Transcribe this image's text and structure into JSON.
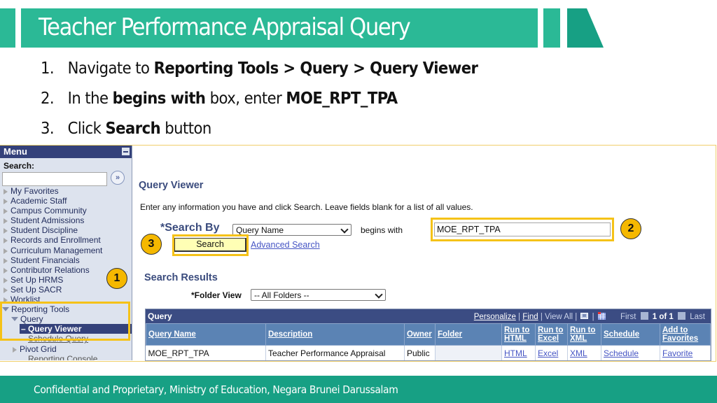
{
  "slide": {
    "title": "Teacher Performance Appraisal Query",
    "steps": [
      {
        "num": "1.",
        "parts": [
          {
            "t": "Navigate to ",
            "b": false
          },
          {
            "t": "Reporting Tools > Query > Query Viewer",
            "b": true
          }
        ]
      },
      {
        "num": "2.",
        "parts": [
          {
            "t": "In the ",
            "b": false
          },
          {
            "t": "begins with",
            "b": true
          },
          {
            "t": " box, enter ",
            "b": false
          },
          {
            "t": "MOE_RPT_TPA",
            "b": true
          }
        ]
      },
      {
        "num": "3.",
        "parts": [
          {
            "t": "Click ",
            "b": false
          },
          {
            "t": "Search",
            "b": true
          },
          {
            "t": " button",
            "b": false
          }
        ]
      }
    ],
    "footer": "Confidential and Proprietary, Ministry of Education, Negara Brunei Darussalam",
    "badges": [
      "1",
      "2",
      "3"
    ],
    "colors": {
      "brand_teal": "#2bb996",
      "footer_teal": "#17a084",
      "highlight": "#f5c218",
      "badge": "#f5b800"
    }
  },
  "menu": {
    "title": "Menu",
    "search_label": "Search:",
    "search_value": "",
    "go_icon": "double-chevron-right-icon",
    "items": [
      {
        "label": "My Favorites",
        "type": "closed"
      },
      {
        "label": "Academic Staff",
        "type": "closed"
      },
      {
        "label": "Campus Community",
        "type": "closed"
      },
      {
        "label": "Student Admissions",
        "type": "closed"
      },
      {
        "label": "Student Discipline",
        "type": "closed"
      },
      {
        "label": "Records and Enrollment",
        "type": "closed"
      },
      {
        "label": "Curriculum Management",
        "type": "closed"
      },
      {
        "label": "Student Financials",
        "type": "closed"
      },
      {
        "label": "Contributor Relations",
        "type": "closed"
      },
      {
        "label": "Set Up HRMS",
        "type": "closed"
      },
      {
        "label": "Set Up SACR",
        "type": "closed"
      },
      {
        "label": "Worklist",
        "type": "closed"
      },
      {
        "label": "Reporting Tools",
        "type": "open"
      },
      {
        "label": "Query",
        "type": "open-sub"
      },
      {
        "label": "– Query Viewer",
        "type": "selected"
      },
      {
        "label": "Schedule Query",
        "type": "sub2"
      },
      {
        "label": "Pivot Grid",
        "type": "closed-sub"
      },
      {
        "label": "Reporting Console",
        "type": "sub2"
      }
    ]
  },
  "query_viewer": {
    "title": "Query Viewer",
    "instructions": "Enter any information you have and click Search. Leave fields blank for a list of all values.",
    "search_by_label": "*Search By",
    "search_by_value": "Query Name",
    "operator_label": "begins with",
    "search_value": "MOE_RPT_TPA",
    "search_button": "Search",
    "advanced_search": "Advanced Search",
    "results_title": "Search Results",
    "folder_view_label": "*Folder View",
    "folder_view_value": "-- All Folders --"
  },
  "results_grid": {
    "title": "Query",
    "nav": {
      "personalize": "Personalize",
      "find": "Find",
      "view_all": "View All",
      "first": "First",
      "count": "1 of 1",
      "last": "Last"
    },
    "columns": [
      "Query Name",
      "Description",
      "Owner",
      "Folder",
      "Run to HTML",
      "Run to Excel",
      "Run to XML",
      "Schedule",
      "Add to Favorites"
    ],
    "rows": [
      [
        "MOE_RPT_TPA",
        "Teacher Performance Appraisal",
        "Public",
        "",
        "HTML",
        "Excel",
        "XML",
        "Schedule",
        "Favorite"
      ]
    ]
  }
}
